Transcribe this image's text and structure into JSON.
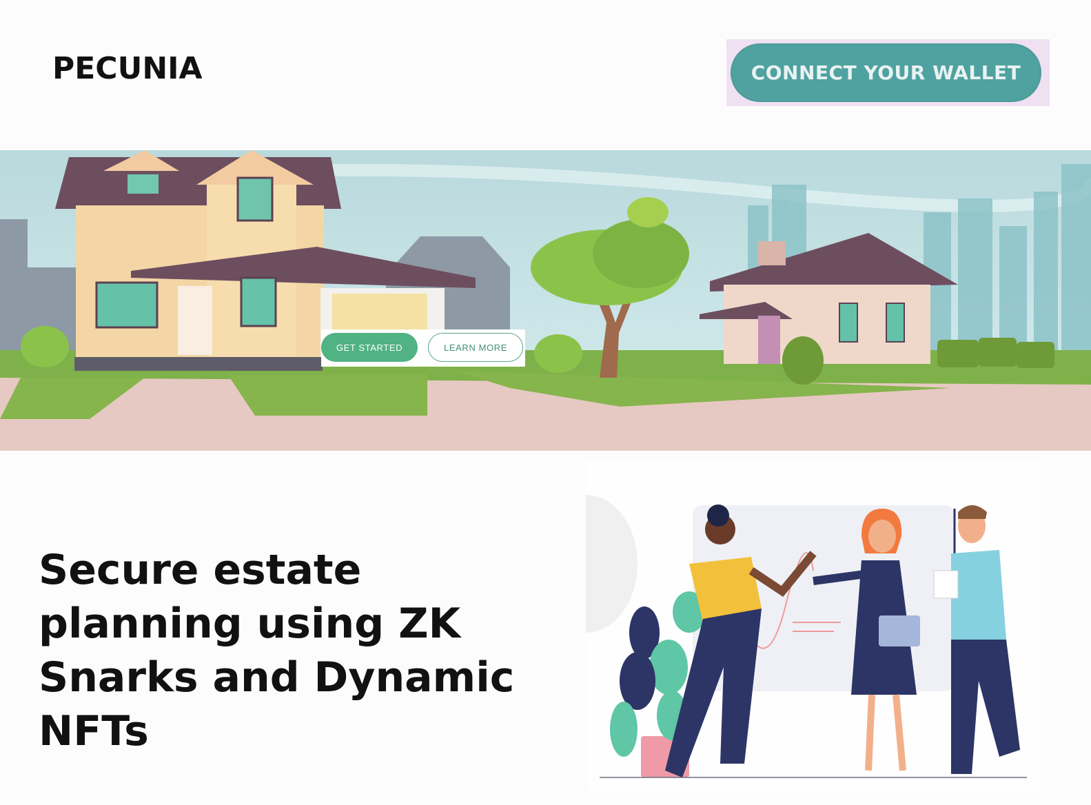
{
  "header": {
    "brand": "PECUNIA",
    "wallet_button": "CONNECT YOUR WALLET"
  },
  "hero": {
    "get_started": "GET STARTED",
    "learn_more": "LEARN MORE"
  },
  "main": {
    "headline": "Secure estate planning using ZK Snarks and Dynamic NFTs"
  },
  "colors": {
    "wallet_button": "#4fa29f",
    "get_started": "#51b283",
    "learn_more_border": "#5aa28c"
  }
}
